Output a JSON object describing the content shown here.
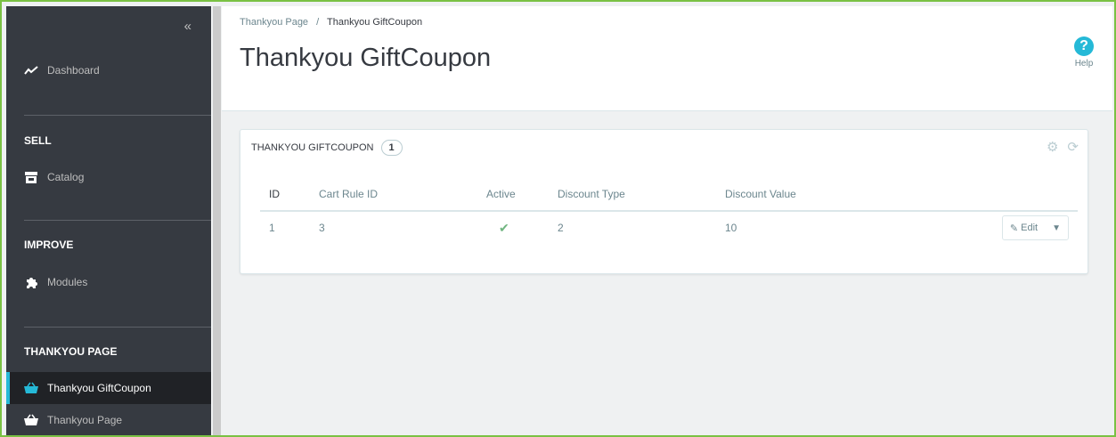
{
  "sidebar": {
    "collapse_label": "«",
    "dashboard": "Dashboard",
    "sell_heading": "SELL",
    "catalog": "Catalog",
    "improve_heading": "IMPROVE",
    "modules": "Modules",
    "thankyou_heading": "THANKYOU PAGE",
    "giftcoupon": "Thankyou GiftCoupon",
    "thankyoupage": "Thankyou Page"
  },
  "header": {
    "breadcrumb_parent": "Thankyou Page",
    "breadcrumb_sep": "/",
    "breadcrumb_current": "Thankyou GiftCoupon",
    "title": "Thankyou GiftCoupon",
    "help_label": "Help",
    "help_icon": "?"
  },
  "panel": {
    "title": "THANKYOU GIFTCOUPON",
    "count": "1",
    "columns": [
      "ID",
      "Cart Rule ID",
      "Active",
      "Discount Type",
      "Discount Value"
    ],
    "rows": [
      {
        "id": "1",
        "cart_rule_id": "3",
        "active": "✔",
        "discount_type": "2",
        "discount_value": "10",
        "edit_label": "Edit"
      }
    ]
  },
  "colors": {
    "sidebar": "#363a41",
    "accent": "#25b9d7",
    "frame": "#7ac143",
    "success": "#70b580"
  }
}
